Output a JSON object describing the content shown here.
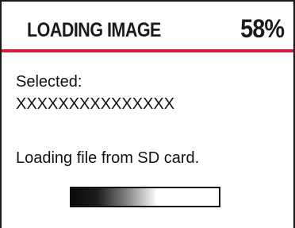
{
  "header": {
    "title": "LOADING IMAGE",
    "percent_text": "58%"
  },
  "colors": {
    "accent": "#d0203a",
    "text": "#111111",
    "border": "#1a1a1a"
  },
  "selection": {
    "label": "Selected:",
    "value": "XXXXXXXXXXXXXXX"
  },
  "status": {
    "message": "Loading file from SD card."
  },
  "progress": {
    "fraction": 0.58
  }
}
